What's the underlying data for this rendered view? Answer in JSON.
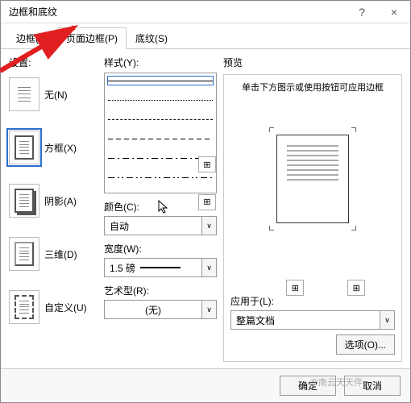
{
  "title": "边框和底纹",
  "titlebar": {
    "help": "?",
    "close": "×"
  },
  "tabs": {
    "border": "边框(B)",
    "page_border": "页面边框(P)",
    "shading": "底纹(S)"
  },
  "settings": {
    "label": "设置:",
    "none": "无(N)",
    "box": "方框(X)",
    "shadow": "阴影(A)",
    "threed": "三维(D)",
    "custom": "自定义(U)"
  },
  "style": {
    "label": "样式(Y):",
    "color_label": "颜色(C):",
    "color_value": "自动",
    "width_label": "宽度(W):",
    "width_value": "1.5 磅",
    "art_label": "艺术型(R):",
    "art_value": "(无)"
  },
  "preview": {
    "label": "预览",
    "hint": "单击下方图示或使用按钮可应用边框",
    "apply_label": "应用于(L):",
    "apply_value": "整篇文档",
    "options": "选项(O)..."
  },
  "footer": {
    "ok": "确定",
    "cancel": "取消"
  },
  "watermark": "@南云天天伴",
  "edge_icon": "⊞",
  "dropdown_icon": "∨"
}
